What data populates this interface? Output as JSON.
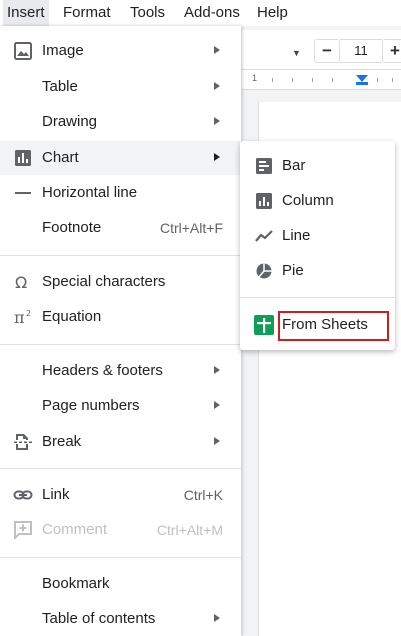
{
  "menubar": {
    "items": [
      "Insert",
      "Format",
      "Tools",
      "Add-ons",
      "Help"
    ],
    "active": "Insert"
  },
  "toolbar": {
    "font_size": "11",
    "decrease_label": "−",
    "increase_label": "+"
  },
  "ruler": {
    "marker_label": "1"
  },
  "insert_menu": {
    "items": [
      {
        "label": "Image",
        "icon": "image-icon"
      },
      {
        "label": "Table"
      },
      {
        "label": "Drawing"
      },
      {
        "label": "Chart",
        "icon": "chart-icon"
      },
      {
        "label": "Horizontal line",
        "icon": "horizontal-line-icon"
      },
      {
        "label": "Footnote",
        "shortcut": "Ctrl+Alt+F"
      },
      {
        "label": "Special characters",
        "icon": "omega-icon"
      },
      {
        "label": "Equation",
        "icon": "pi-icon"
      },
      {
        "label": "Headers & footers"
      },
      {
        "label": "Page numbers"
      },
      {
        "label": "Break",
        "icon": "break-icon"
      },
      {
        "label": "Link",
        "icon": "link-icon",
        "shortcut": "Ctrl+K"
      },
      {
        "label": "Comment",
        "icon": "comment-add-icon",
        "shortcut": "Ctrl+Alt+M",
        "disabled": true
      },
      {
        "label": "Bookmark"
      },
      {
        "label": "Table of contents"
      }
    ]
  },
  "chart_submenu": {
    "items": [
      {
        "label": "Bar",
        "icon": "bar-chart-icon"
      },
      {
        "label": "Column",
        "icon": "column-chart-icon"
      },
      {
        "label": "Line",
        "icon": "line-chart-icon"
      },
      {
        "label": "Pie",
        "icon": "pie-chart-icon"
      },
      {
        "label": "From Sheets",
        "icon": "sheets-icon"
      }
    ]
  },
  "colors": {
    "sheets_green": "#0f9d58",
    "highlight_red": "#cc1f1f",
    "ruler_blue": "#1a73e8"
  }
}
